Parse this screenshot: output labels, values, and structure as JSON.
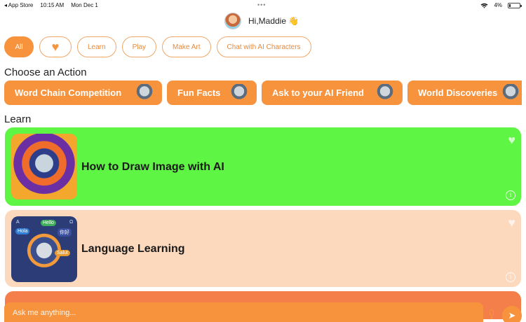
{
  "status_bar": {
    "back_app": "◂ App Store",
    "time": "10:15 AM",
    "date": "Mon Dec 1",
    "multitask": "•••",
    "battery": "4%",
    "battery_level": 0.04
  },
  "header": {
    "greeting": "Hi,Maddie 👋"
  },
  "filters": [
    {
      "label": "All",
      "active": true
    },
    {
      "label": "",
      "icon": "heart-icon"
    },
    {
      "label": "Learn"
    },
    {
      "label": "Play"
    },
    {
      "label": "Make Art"
    },
    {
      "label": "Chat with AI Characters"
    }
  ],
  "sections": {
    "actions_title": "Choose an Action",
    "learn_title": "Learn"
  },
  "actions": [
    {
      "label": "Word Chain Competition"
    },
    {
      "label": "Fun Facts"
    },
    {
      "label": "Ask to your AI Friend"
    },
    {
      "label": "World Discoveries"
    }
  ],
  "learn_cards": [
    {
      "title": "How to Draw Image with AI",
      "color": "#5ff545"
    },
    {
      "title": "Language Learning",
      "color": "#fcd8bd"
    },
    {
      "title": "",
      "color": "#f57f4a"
    }
  ],
  "thumb_lang_words": {
    "w1": "Hello",
    "w2": "Hola",
    "w3": "你好",
    "w4": "Salut",
    "w5": "A",
    "w6": "Ω"
  },
  "input": {
    "placeholder": "Ask me anything..."
  },
  "colors": {
    "accent": "#f7933d",
    "green_card": "#5ff545",
    "peach_card": "#fcd8bd"
  }
}
